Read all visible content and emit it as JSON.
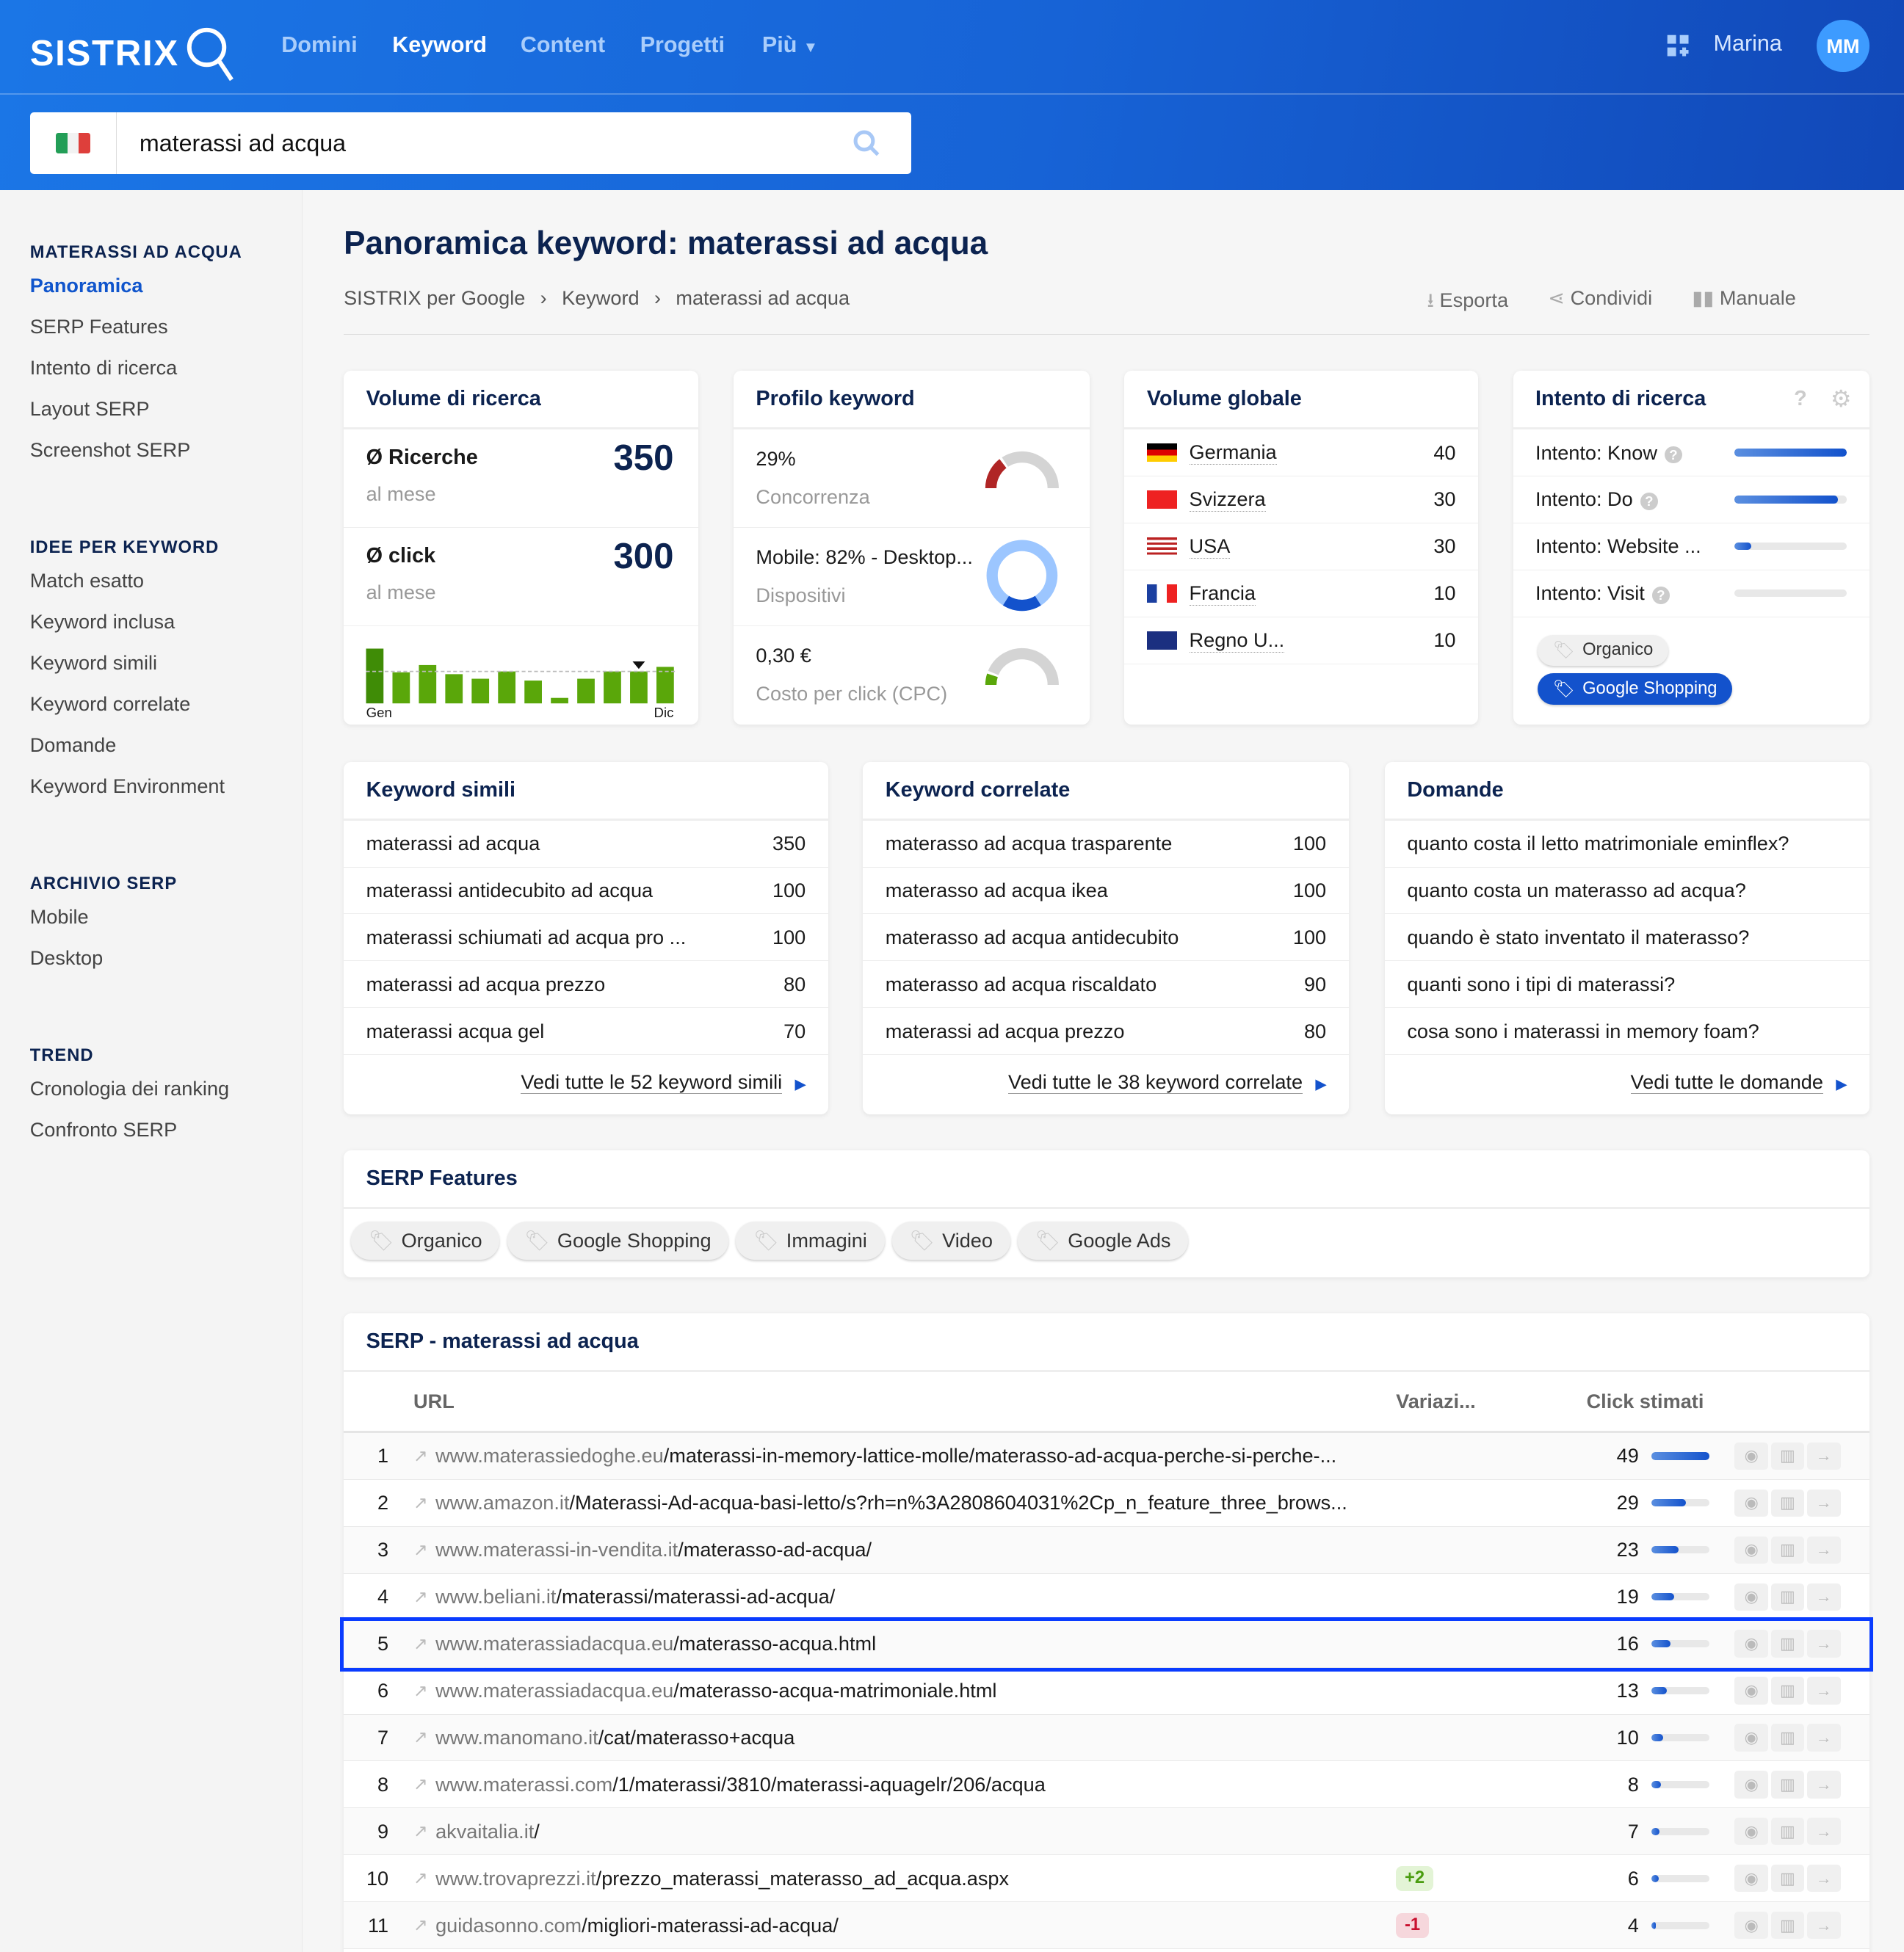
{
  "header": {
    "logo": "SISTRIX",
    "nav": [
      "Domini",
      "Keyword",
      "Content",
      "Progetti",
      "Più"
    ],
    "active_nav": "Keyword",
    "user": "Marina",
    "avatar": "MM",
    "search_value": "materassi ad acqua",
    "country": "Italy"
  },
  "sidebar": {
    "sections": [
      {
        "title": "MATERASSI AD ACQUA",
        "items": [
          "Panoramica",
          "SERP Features",
          "Intento di ricerca",
          "Layout SERP",
          "Screenshot SERP"
        ]
      },
      {
        "title": "IDEE PER KEYWORD",
        "items": [
          "Match esatto",
          "Keyword inclusa",
          "Keyword simili",
          "Keyword correlate",
          "Domande",
          "Keyword Environment"
        ]
      },
      {
        "title": "ARCHIVIO SERP",
        "items": [
          "Mobile",
          "Desktop"
        ]
      },
      {
        "title": "TREND",
        "items": [
          "Cronologia dei ranking",
          "Confronto SERP"
        ]
      }
    ],
    "active": "Panoramica"
  },
  "page": {
    "title": "Panoramica keyword: materassi ad acqua",
    "breadcrumb": [
      "SISTRIX per Google",
      "Keyword",
      "materassi ad acqua"
    ],
    "actions": [
      "Esporta",
      "Condividi",
      "Manuale"
    ]
  },
  "volume": {
    "title": "Volume di ricerca",
    "searches_label": "Ø Ricerche",
    "searches": "350",
    "searches_sub": "al mese",
    "clicks_label": "Ø click",
    "clicks": "300",
    "clicks_sub": "al mese",
    "month_start": "Gen",
    "month_end": "Dic",
    "chart_data": {
      "type": "bar",
      "categories": [
        "Gen",
        "Feb",
        "Mar",
        "Apr",
        "Mag",
        "Giu",
        "Lug",
        "Ago",
        "Set",
        "Ott",
        "Nov",
        "Dic"
      ],
      "values": [
        600,
        340,
        420,
        320,
        270,
        350,
        250,
        60,
        270,
        350,
        350,
        400
      ],
      "average": 350,
      "marker": "Nov"
    }
  },
  "profile": {
    "title": "Profilo keyword",
    "competition": "29%",
    "competition_label": "Concorrenza",
    "competition_value": 0.29,
    "devices": "Mobile: 82% - Desktop...",
    "devices_label": "Dispositivi",
    "mobile_share": 0.82,
    "cpc": "0,30 €",
    "cpc_label": "Costo per click (CPC)",
    "cpc_level": 0.05
  },
  "global": {
    "title": "Volume globale",
    "rows": [
      {
        "country": "Germania",
        "value": "40"
      },
      {
        "country": "Svizzera",
        "value": "30"
      },
      {
        "country": "USA",
        "value": "30"
      },
      {
        "country": "Francia",
        "value": "10"
      },
      {
        "country": "Regno U...",
        "value": "10"
      }
    ]
  },
  "intent": {
    "title": "Intento di ricerca",
    "rows": [
      {
        "label": "Intento: Know",
        "level": 1.0,
        "help": true
      },
      {
        "label": "Intento: Do",
        "level": 0.92,
        "help": true
      },
      {
        "label": "Intento: Website ...",
        "level": 0.15,
        "help": false
      },
      {
        "label": "Intento: Visit",
        "level": 0,
        "help": true
      }
    ],
    "tags": [
      "Organico",
      "Google Shopping"
    ],
    "active_tag": "Google Shopping"
  },
  "similar": {
    "title": "Keyword simili",
    "rows": [
      [
        "materassi ad acqua",
        "350"
      ],
      [
        "materassi antidecubito ad acqua",
        "100"
      ],
      [
        "materassi schiumati ad acqua pro ...",
        "100"
      ],
      [
        "materassi ad acqua prezzo",
        "80"
      ],
      [
        "materassi acqua gel",
        "70"
      ]
    ],
    "more": "Vedi tutte le 52 keyword simili"
  },
  "related": {
    "title": "Keyword correlate",
    "rows": [
      [
        "materasso ad acqua trasparente",
        "100"
      ],
      [
        "materasso ad acqua ikea",
        "100"
      ],
      [
        "materasso ad acqua antidecubito",
        "100"
      ],
      [
        "materasso ad acqua riscaldato",
        "90"
      ],
      [
        "materassi ad acqua prezzo",
        "80"
      ]
    ],
    "more": "Vedi tutte le 38 keyword correlate"
  },
  "questions": {
    "title": "Domande",
    "rows": [
      "quanto costa il letto matrimoniale eminflex?",
      "quanto costa un materasso ad acqua?",
      "quando è stato inventato il materasso?",
      "quanti sono i tipi di materassi?",
      "cosa sono i materassi in memory foam?"
    ],
    "more": "Vedi tutte le domande"
  },
  "features": {
    "title": "SERP Features",
    "chips": [
      "Organico",
      "Google Shopping",
      "Immagini",
      "Video",
      "Google Ads"
    ]
  },
  "serp": {
    "title": "SERP - materassi ad acqua",
    "columns": [
      "URL",
      "Variazi...",
      "Click stimati"
    ],
    "rows": [
      {
        "pos": "1",
        "domain": "www.materassiedoghe.eu",
        "path": "/materassi-in-memory-lattice-molle/materasso-ad-acqua-perche-si-perche-...",
        "change": "",
        "clicks": 49
      },
      {
        "pos": "2",
        "domain": "www.amazon.it",
        "path": "/Materassi-Ad-acqua-basi-letto/s?rh=n%3A2808604031%2Cp_n_feature_three_brows...",
        "change": "",
        "clicks": 29
      },
      {
        "pos": "3",
        "domain": "www.materassi-in-vendita.it",
        "path": "/materasso-ad-acqua/",
        "change": "",
        "clicks": 23
      },
      {
        "pos": "4",
        "domain": "www.beliani.it",
        "path": "/materassi/materassi-ad-acqua/",
        "change": "",
        "clicks": 19
      },
      {
        "pos": "5",
        "domain": "www.materassiadacqua.eu",
        "path": "/materasso-acqua.html",
        "change": "",
        "clicks": 16,
        "highlight": true
      },
      {
        "pos": "6",
        "domain": "www.materassiadacqua.eu",
        "path": "/materasso-acqua-matrimoniale.html",
        "change": "",
        "clicks": 13
      },
      {
        "pos": "7",
        "domain": "www.manomano.it",
        "path": "/cat/materasso+acqua",
        "change": "",
        "clicks": 10
      },
      {
        "pos": "8",
        "domain": "www.materassi.com",
        "path": "/1/materassi/3810/materassi-aquagelr/206/acqua",
        "change": "",
        "clicks": 8
      },
      {
        "pos": "9",
        "domain": "akvaitalia.it",
        "path": "/",
        "change": "",
        "clicks": 7
      },
      {
        "pos": "10",
        "domain": "www.trovaprezzi.it",
        "path": "/prezzo_materassi_materasso_ad_acqua.aspx",
        "change": "+2",
        "clicks": 6
      },
      {
        "pos": "11",
        "domain": "guidasonno.com",
        "path": "/migliori-materassi-ad-acqua/",
        "change": "-1",
        "clicks": 4
      }
    ]
  },
  "colors": {
    "brand": "#1763d6",
    "navy": "#0c2350",
    "bar_green": "#5aa70a",
    "competition_red": "#b02525",
    "highlight": "#0a3cff"
  }
}
